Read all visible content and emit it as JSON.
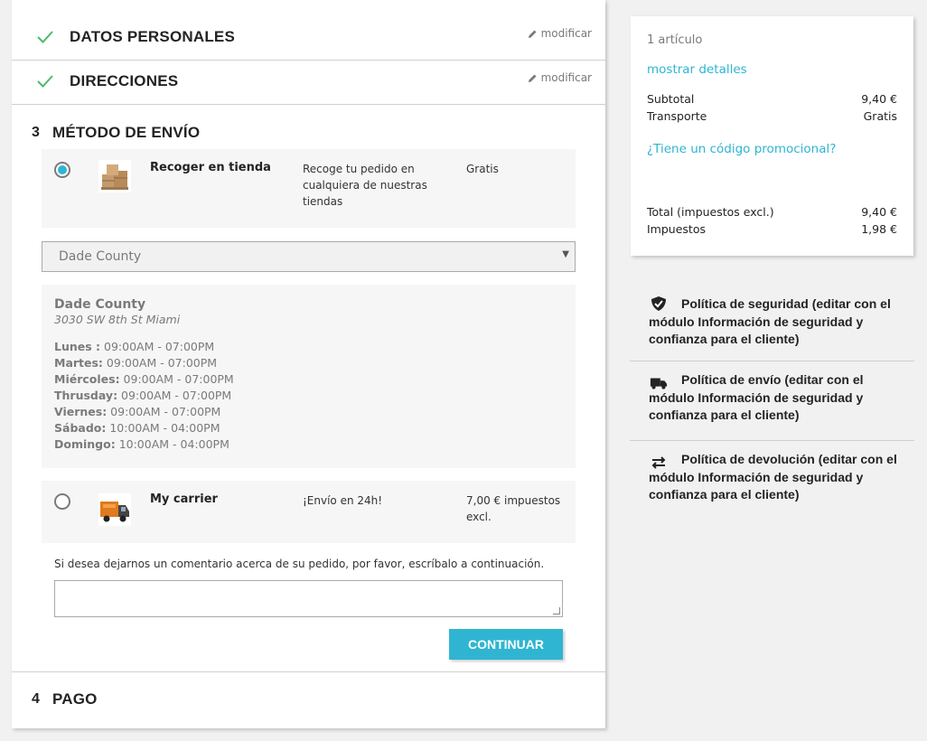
{
  "steps": {
    "personal": {
      "title": "DATOS PERSONALES",
      "modify": "modificar"
    },
    "addresses": {
      "title": "DIRECCIONES",
      "modify": "modificar"
    },
    "shipping": {
      "number": "3",
      "title": "MÉTODO DE ENVÍO"
    },
    "payment": {
      "number": "4",
      "title": "PAGO"
    }
  },
  "carriers": [
    {
      "name": "Recoger en tienda",
      "description": "Recoge tu pedido en cualquiera de nuestras tiendas",
      "price": "Gratis",
      "selected": true,
      "icon": "boxes-icon"
    },
    {
      "name": "My carrier",
      "description": "¡Envío en 24h!",
      "price": "7,00 € impuestos excl.",
      "selected": false,
      "icon": "truck-icon"
    }
  ],
  "store_select": {
    "value": "Dade County"
  },
  "store": {
    "name": "Dade County",
    "address": "3030 SW 8th St Miami",
    "hours": [
      {
        "day": "Lunes :",
        "time": " 09:00AM - 07:00PM"
      },
      {
        "day": "Martes:",
        "time": " 09:00AM - 07:00PM"
      },
      {
        "day": "Miércoles:",
        "time": " 09:00AM - 07:00PM"
      },
      {
        "day": "Thrusday:",
        "time": " 09:00AM - 07:00PM"
      },
      {
        "day": "Viernes:",
        "time": " 09:00AM - 07:00PM"
      },
      {
        "day": "Sábado:",
        "time": " 10:00AM - 04:00PM"
      },
      {
        "day": "Domingo:",
        "time": " 10:00AM - 04:00PM"
      }
    ]
  },
  "comment": {
    "label": "Si desea dejarnos un comentario acerca de su pedido, por favor, escríbalo a continuación.",
    "value": ""
  },
  "continue_label": "CONTINUAR",
  "summary": {
    "items_count": "1 artículo",
    "show_details": "mostrar detalles",
    "subtotal_label": "Subtotal",
    "subtotal_value": "9,40 €",
    "shipping_label": "Transporte",
    "shipping_value": "Gratis",
    "promo_link": "¿Tiene un código promocional?",
    "total_label": "Total (impuestos excl.)",
    "total_value": "9,40 €",
    "taxes_label": "Impuestos",
    "taxes_value": "1,98 €"
  },
  "reassurance": [
    {
      "text": "Política de seguridad (editar con el módulo Información de seguridad y confianza para el cliente)",
      "icon": "shield-icon"
    },
    {
      "text": "Política de envío (editar con el módulo Información de seguridad y confianza para el cliente)",
      "icon": "truck-icon"
    },
    {
      "text": "Política de devolución (editar con el módulo Información de seguridad y confianza para el cliente)",
      "icon": "swap-arrows-icon"
    }
  ],
  "colors": {
    "accent": "#2fb5d2",
    "check": "#4cbb6c",
    "background": "#f1f1f1"
  }
}
